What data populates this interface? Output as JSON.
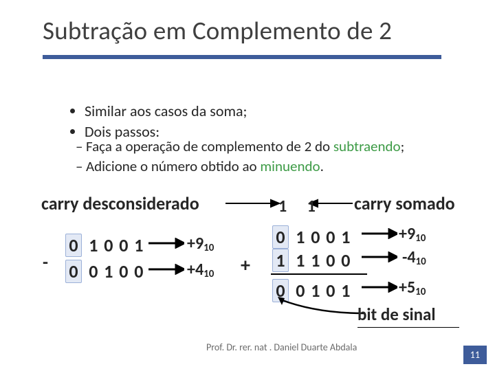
{
  "title": "Subtração em Complemento de 2",
  "bullets": {
    "b1": "Similar aos casos da soma;",
    "b2": "Dois passos:"
  },
  "subs": {
    "s1a": "Faça a operação de complemento de 2 do ",
    "s1kw": "subtraendo",
    "s1b": ";",
    "s2a": "Adicione o número obtido ao ",
    "s2kw": "minuendo",
    "s2b": "."
  },
  "labels": {
    "carryL": "carry desconsiderado",
    "carryR": "carry somado",
    "bitde": "bit de sinal"
  },
  "left": {
    "row1": [
      "0",
      "1",
      "0",
      "0",
      "1"
    ],
    "row2": [
      "0",
      "0",
      "1",
      "0",
      "0"
    ],
    "val1": "+9",
    "val2": "+4"
  },
  "right": {
    "carry": "1 1",
    "row1": [
      "0",
      "1",
      "0",
      "0",
      "1"
    ],
    "row2": [
      "1",
      "1",
      "1",
      "0",
      "0"
    ],
    "row3": [
      "0",
      "0",
      "1",
      "0",
      "1"
    ],
    "val1": "+9",
    "val2": "-4",
    "val3": "+5"
  },
  "sub10": "10",
  "minus": "-",
  "plus": "+",
  "footer": "Prof. Dr. rer. nat . Daniel Duarte Abdala",
  "page": "11"
}
